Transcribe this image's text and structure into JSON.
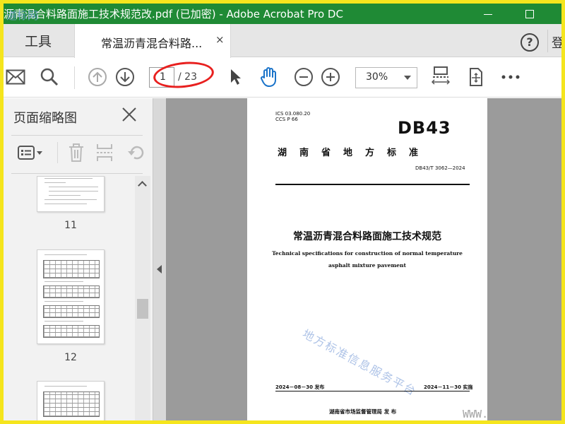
{
  "window": {
    "title": "沥青混合料路面施工技术规范改.pdf  (已加密)  - Adobe Acrobat Pro DC",
    "watermark": "道标网"
  },
  "tabs": {
    "tools_label": "工具",
    "doc_label": "常温沥青混合料路...",
    "close_glyph": "×",
    "help_glyph": "?",
    "login_label": "登"
  },
  "toolbar": {
    "page_current": "1",
    "page_total": "/ 23",
    "zoom": "30%"
  },
  "sidebar": {
    "title": "页面缩略图",
    "thumbnails": [
      {
        "label": "11"
      },
      {
        "label": "12"
      },
      {
        "label": ""
      }
    ]
  },
  "document": {
    "ics": "ICS 03.080.20",
    "ccs": "CCS P 66",
    "db": "DB43",
    "local_standard": "湖南省地方标准",
    "code": "DB43/T 3062—2024",
    "title_cn": "常温沥青混合料路面施工技术规范",
    "title_en_1": "Technical specifications for construction of normal temperature",
    "title_en_2": "asphalt mixture pavement",
    "watermark": "地方标准信息服务平台",
    "publish": "2024－08－30 发布",
    "implement": "2024－11－30 实施",
    "issuer": "湖南省市场监督管理局    发 布",
    "corner_watermark": "WWW."
  },
  "colors": {
    "title_bar": "#1f8a35",
    "highlight_circle": "#e8201f",
    "border": "#f5e51d"
  }
}
